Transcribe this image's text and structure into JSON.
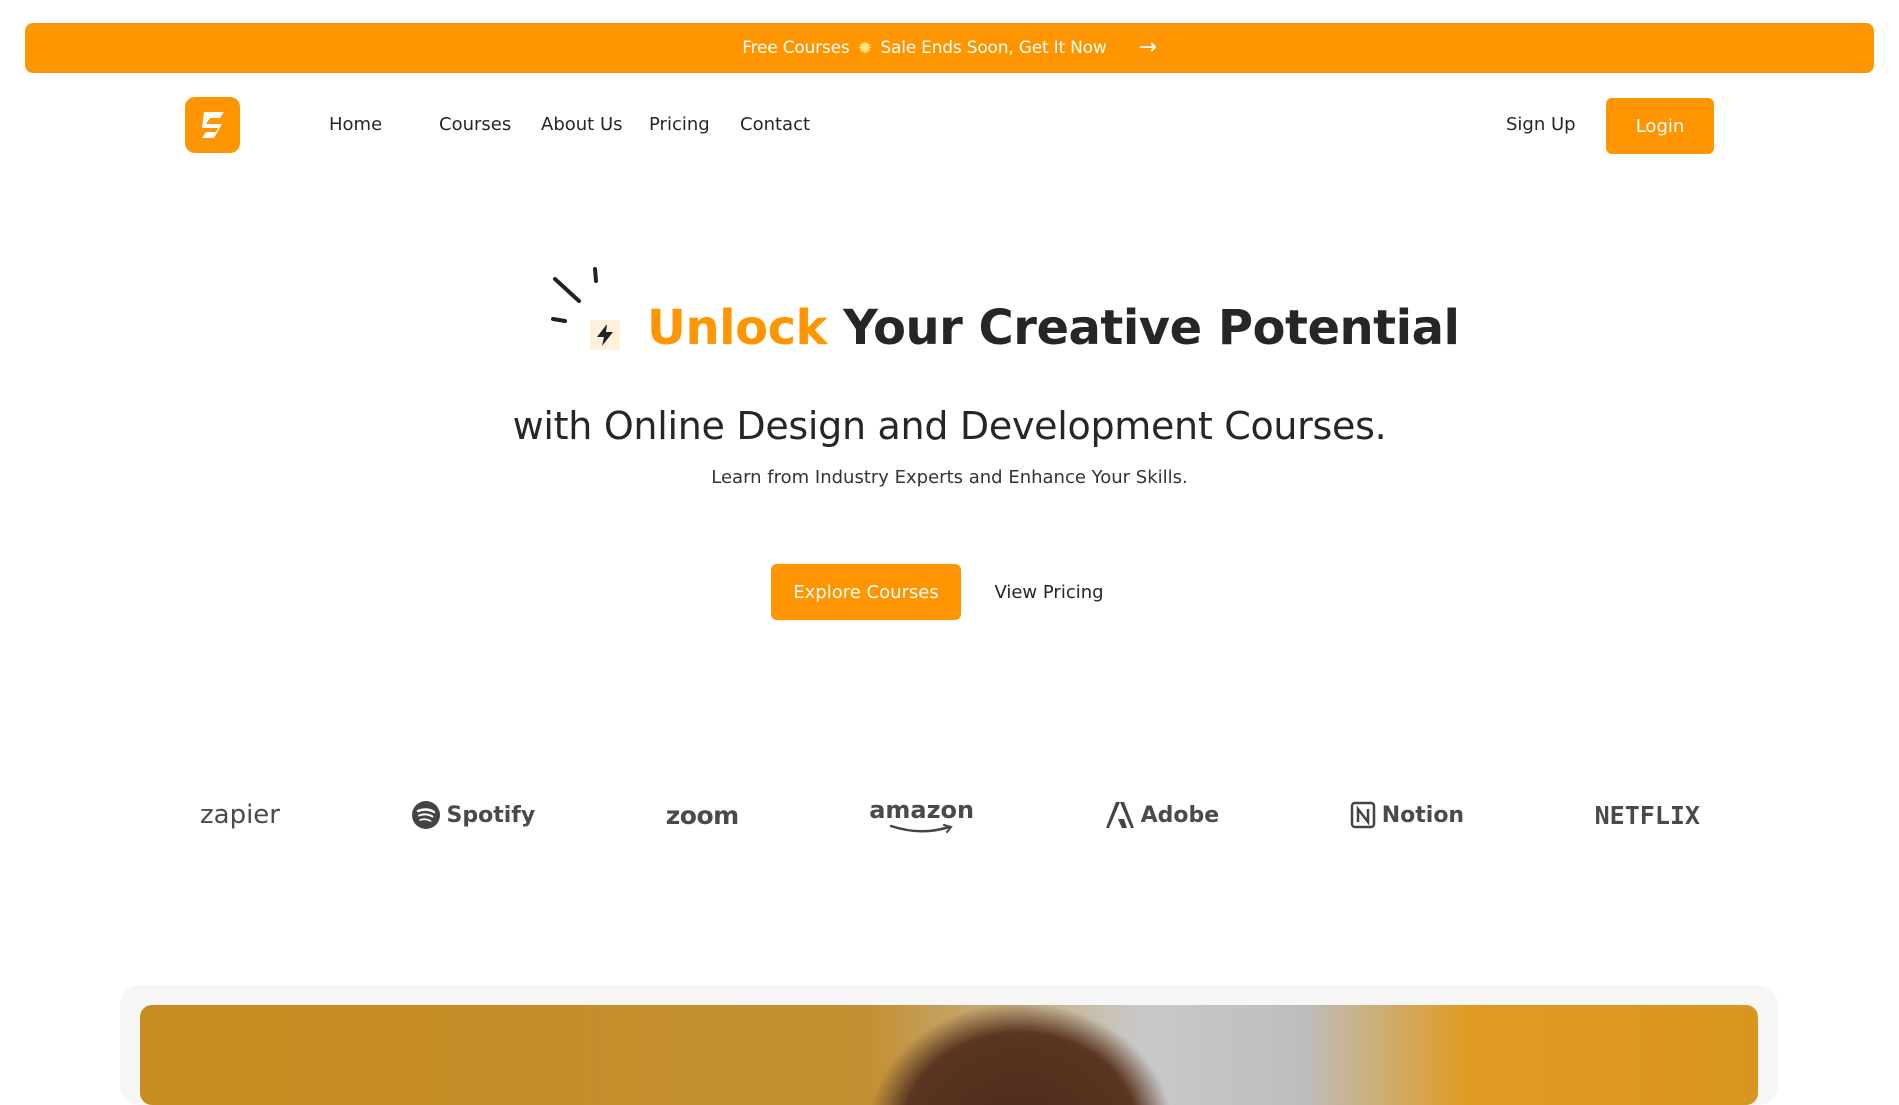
{
  "promo": {
    "text_left": "Free Courses",
    "icon": "sun-icon",
    "text_right": "Sale Ends Soon, Get It Now",
    "arrow_icon": "arrow-right-icon"
  },
  "nav": {
    "logo_letter": "S",
    "links": [
      "Home",
      "Courses",
      "About Us",
      "Pricing",
      "Contact"
    ],
    "signup": "Sign Up",
    "login": "Login"
  },
  "hero": {
    "title_accent": "Unlock",
    "title_rest": "Your Creative Potential",
    "subtitle": "with Online Design and Development Courses.",
    "description": "Learn from Industry Experts and Enhance Your Skills.",
    "primary_cta": "Explore Courses",
    "secondary_cta": "View Pricing"
  },
  "brands": [
    "zapier",
    "Spotify",
    "zoom",
    "amazon",
    "Adobe",
    "Notion",
    "NETFLIX"
  ],
  "colors": {
    "accent": "#ff9500",
    "text": "#262626",
    "accent_light": "#fff1dc"
  }
}
